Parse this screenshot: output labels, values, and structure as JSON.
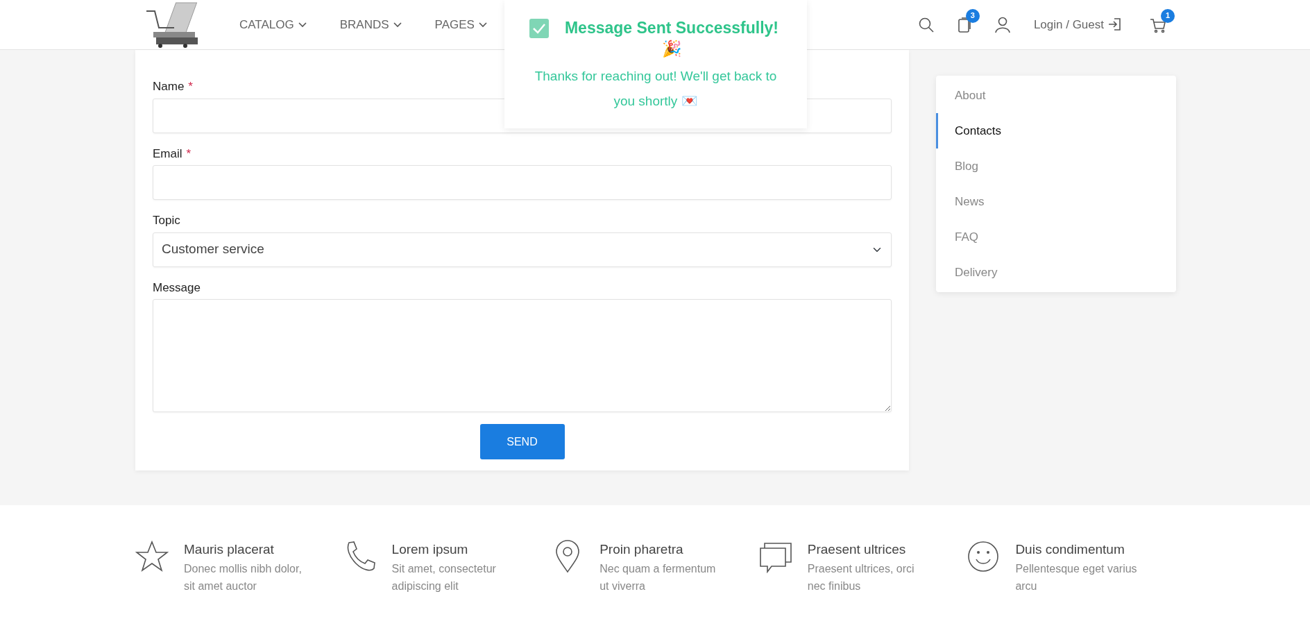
{
  "header": {
    "nav": [
      {
        "label": "CATALOG"
      },
      {
        "label": "BRANDS"
      },
      {
        "label": "PAGES"
      }
    ],
    "compare_count": "3",
    "login": "Login / Guest",
    "cart_count": "1"
  },
  "toast": {
    "title": "Message Sent Successfully! 🎉",
    "message": "Thanks for reaching out! We'll get back to you shortly 💌"
  },
  "form": {
    "fields": [
      {
        "kind": "input",
        "label": "Name",
        "required_mark": "*"
      },
      {
        "kind": "input",
        "label": "Email",
        "required_mark": "*"
      },
      {
        "kind": "select",
        "label": "Topic",
        "value": "Customer service"
      },
      {
        "kind": "textarea",
        "label": "Message"
      }
    ],
    "submit": "SEND"
  },
  "sidebar": {
    "items": [
      {
        "label": "About",
        "selected": false
      },
      {
        "label": "Contacts",
        "selected": true
      },
      {
        "label": "Blog",
        "selected": false
      },
      {
        "label": "News",
        "selected": false
      },
      {
        "label": "FAQ",
        "selected": false
      },
      {
        "label": "Delivery",
        "selected": false
      }
    ]
  },
  "features": [
    {
      "title": "Mauris placerat",
      "text": "Donec mollis nibh dolor, sit amet auctor"
    },
    {
      "title": "Lorem ipsum",
      "text": "Sit amet, consectetur adipiscing elit"
    },
    {
      "title": "Proin pharetra",
      "text": "Nec quam a fermentum ut viverra"
    },
    {
      "title": "Praesent ultrices",
      "text": "Praesent ultrices, orci nec finibus"
    },
    {
      "title": "Duis condimentum",
      "text": "Pellentesque eget varius arcu"
    }
  ]
}
